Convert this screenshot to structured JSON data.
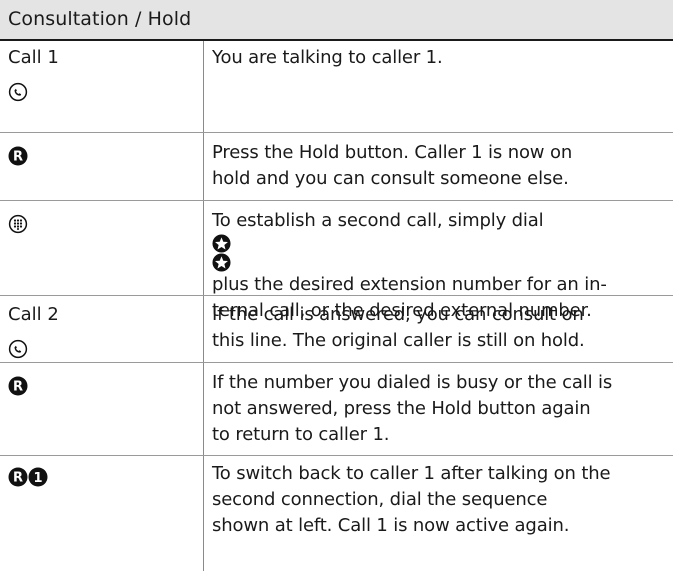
{
  "header": {
    "title": "Consultation / Hold"
  },
  "rows": [
    {
      "left_label": "Call 1",
      "left_icons": [
        "handset-icon"
      ],
      "right_lines": [
        "You are talking to caller 1."
      ]
    },
    {
      "left_label": "",
      "left_icons": [
        "r-key-icon"
      ],
      "right_lines": [
        "Press the Hold button. Caller 1 is now on",
        "hold and you can consult someone else."
      ]
    },
    {
      "left_label": "",
      "left_icons": [
        "keypad-icon"
      ],
      "right_lines": [
        "To establish a second call, simply dial",
        "plus the desired extension number for an in-",
        "ternal call, or the desired external number."
      ],
      "inline_icons": [
        "star-key-icon",
        "star-key-icon"
      ]
    },
    {
      "left_label": "Call 2",
      "left_icons": [
        "handset-icon"
      ],
      "right_lines": [
        "If the call is answered, you can consult on",
        "this line. The original caller is still on hold."
      ]
    },
    {
      "left_label": "",
      "left_icons": [
        "r-key-icon"
      ],
      "right_lines": [
        "If the number you dialed is busy or the call is",
        "not answered, press the Hold button again",
        "to return to caller 1."
      ]
    },
    {
      "left_label": "",
      "left_icons": [
        "r-key-icon",
        "one-key-icon"
      ],
      "right_lines": [
        "To switch back to caller 1 after talking on the",
        "second connection, dial the sequence",
        "shown at left. Call 1 is now active again."
      ]
    }
  ]
}
